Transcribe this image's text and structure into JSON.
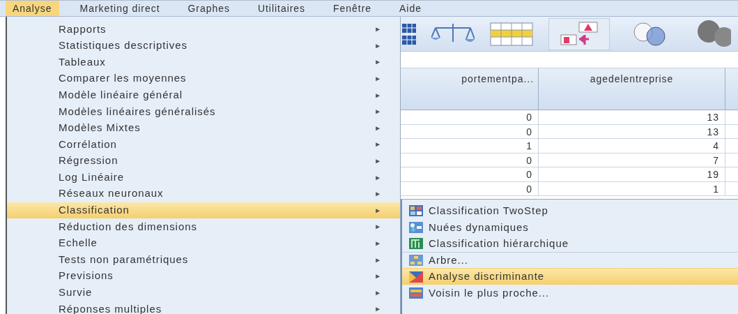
{
  "menubar": [
    {
      "label": "Analyse",
      "selected": true
    },
    {
      "label": "Marketing direct",
      "selected": false
    },
    {
      "label": "Graphes",
      "selected": false
    },
    {
      "label": "Utilitaires",
      "selected": false
    },
    {
      "label": "Fenêtre",
      "selected": false
    },
    {
      "label": "Aide",
      "selected": false
    }
  ],
  "menu": {
    "arrow": "►",
    "items": [
      {
        "label": "Rapports",
        "selected": false
      },
      {
        "label": "Statistiques descriptives",
        "selected": false
      },
      {
        "label": "Tableaux",
        "selected": false
      },
      {
        "label": "Comparer les moyennes",
        "selected": false
      },
      {
        "label": "Modèle linéaire général",
        "selected": false
      },
      {
        "label": "Modèles linéaires généralisés",
        "selected": false
      },
      {
        "label": "Modèles Mixtes",
        "selected": false
      },
      {
        "label": "Corrélation",
        "selected": false
      },
      {
        "label": "Régression",
        "selected": false
      },
      {
        "label": "Log Linéaire",
        "selected": false
      },
      {
        "label": "Réseaux neuronaux",
        "selected": false
      },
      {
        "label": "Classification",
        "selected": true
      },
      {
        "label": "Réduction des dimensions",
        "selected": false
      },
      {
        "label": "Echelle",
        "selected": false
      },
      {
        "label": "Tests non paramétriques",
        "selected": false
      },
      {
        "label": "Previsions",
        "selected": false
      },
      {
        "label": "Survie",
        "selected": false
      },
      {
        "label": "Réponses multiples",
        "selected": false
      }
    ]
  },
  "table": {
    "columns": [
      "portementpa...",
      "agedelentreprise"
    ],
    "rows": [
      [
        "0",
        "13"
      ],
      [
        "0",
        "13"
      ],
      [
        "1",
        "4"
      ],
      [
        "0",
        "7"
      ],
      [
        "0",
        "19"
      ],
      [
        "0",
        "1"
      ]
    ]
  },
  "submenu": {
    "items": [
      {
        "label": "Classification TwoStep",
        "selected": false,
        "divider_above": false
      },
      {
        "label": "Nuées dynamiques",
        "selected": false,
        "divider_above": false
      },
      {
        "label": "Classification hiérarchique",
        "selected": false,
        "divider_above": false
      },
      {
        "label": "Arbre...",
        "selected": false,
        "divider_above": true
      },
      {
        "label": "Analyse discriminante",
        "selected": true,
        "divider_above": false
      },
      {
        "label": "Voisin le plus proche...",
        "selected": false,
        "divider_above": false
      }
    ]
  }
}
